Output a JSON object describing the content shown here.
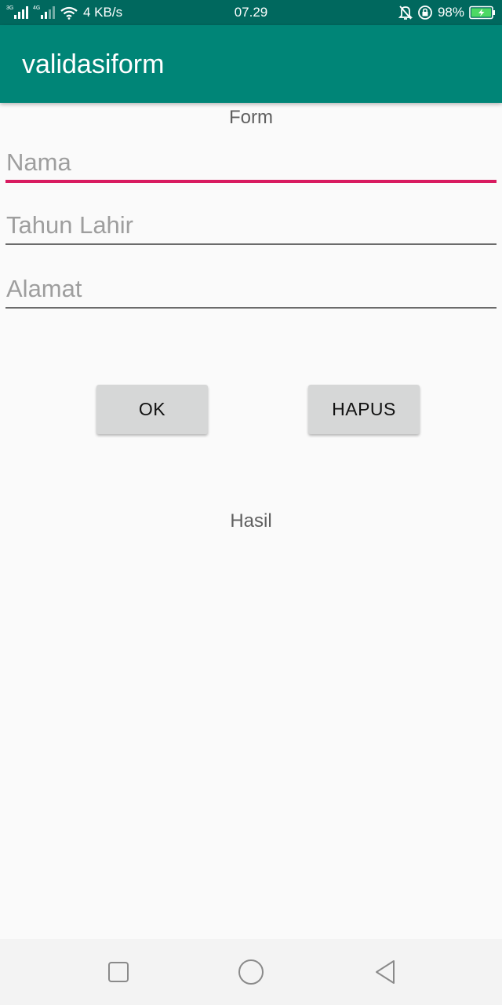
{
  "status_bar": {
    "network_tag_1": "3G",
    "network_tag_2": "4G",
    "speed": "4 KB/s",
    "time": "07.29",
    "battery": "98%",
    "icons": [
      "signal-3g-icon",
      "signal-4g-icon",
      "wifi-icon",
      "mute-bell-icon",
      "rotation-lock-icon",
      "battery-charging-icon"
    ]
  },
  "app_bar": {
    "title": "validasiform"
  },
  "form": {
    "heading": "Form",
    "fields": [
      {
        "placeholder": "Nama",
        "value": ""
      },
      {
        "placeholder": "Tahun Lahir",
        "value": ""
      },
      {
        "placeholder": "Alamat",
        "value": ""
      }
    ]
  },
  "buttons": {
    "ok": "OK",
    "hapus": "HAPUS"
  },
  "result": {
    "text": "Hasil"
  },
  "nav_bar": {
    "icons": [
      "recents-square-icon",
      "home-circle-icon",
      "back-triangle-icon"
    ]
  },
  "colors": {
    "status_bar": "#00685e",
    "app_bar": "#008577",
    "accent": "#d81b60",
    "background": "#fafafa"
  }
}
